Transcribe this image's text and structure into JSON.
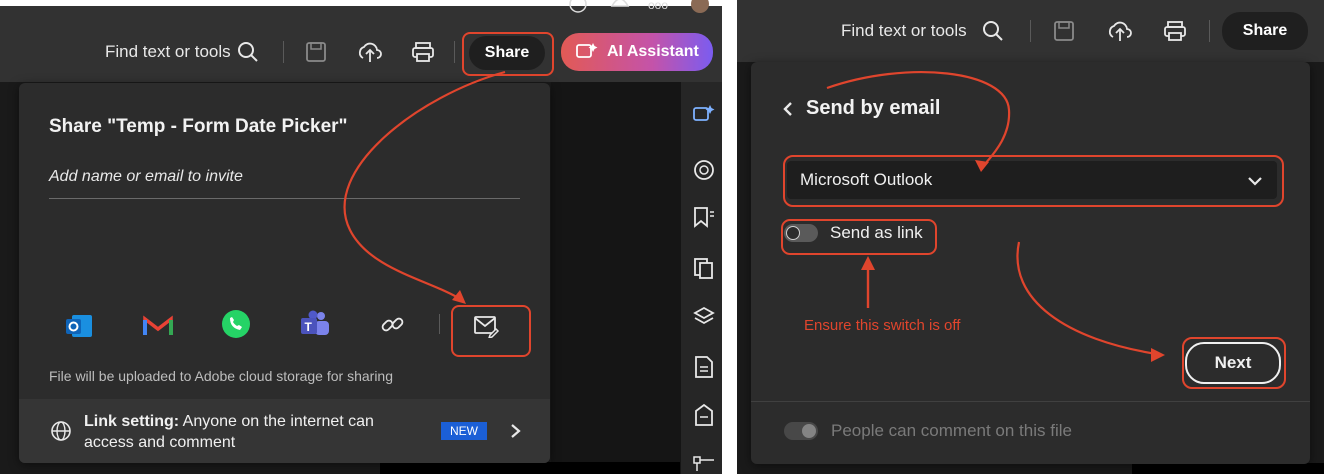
{
  "left": {
    "toolbar": {
      "find_label": "Find text or tools",
      "share_label": "Share",
      "ai_label": "AI Assistant"
    },
    "share_dialog": {
      "title": "Share \"Temp - Form Date Picker\"",
      "invite_placeholder": "Add name or email to invite",
      "upload_note": "File will be uploaded to Adobe cloud storage for sharing",
      "link_setting_label": "Link setting:",
      "link_setting_value_line1": "Anyone on the internet can",
      "link_setting_value_line2": "access and comment",
      "new_badge": "NEW",
      "share_targets": [
        "outlook-icon",
        "gmail-icon",
        "whatsapp-icon",
        "teams-icon",
        "link-icon",
        "email-icon"
      ]
    },
    "rail_icons": [
      "ai-sparkle-icon",
      "comment-icon",
      "bookmark-icon",
      "pages-icon",
      "layers-icon",
      "document-icon",
      "attachment-icon",
      "structure-icon"
    ]
  },
  "right": {
    "toolbar": {
      "find_label": "Find text or tools",
      "share_label": "Share"
    },
    "email_dialog": {
      "back_title": "Send by email",
      "client_selected": "Microsoft Outlook",
      "send_as_link_label": "Send as link",
      "next_label": "Next",
      "comment_toggle_label": "People can comment on this file"
    },
    "annotation": "Ensure this switch is off"
  },
  "colors": {
    "callout": "#e0452d",
    "panel_bg": "#2c2c2c",
    "toolbar_bg": "#323232",
    "new_badge": "#1b5fd6"
  }
}
